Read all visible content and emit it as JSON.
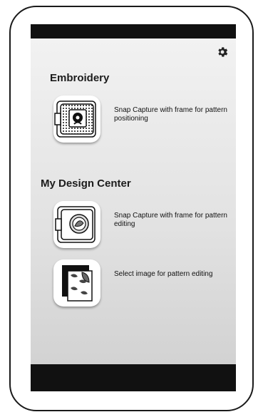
{
  "sections": {
    "embroidery": {
      "title": "Embroidery",
      "items": [
        {
          "label": "Snap Capture with frame for pattern positioning",
          "icon": "embroidery-frame-icon"
        }
      ]
    },
    "design_center": {
      "title": "My Design Center",
      "items": [
        {
          "label": "Snap Capture with frame for pattern editing",
          "icon": "design-frame-icon"
        },
        {
          "label": "Select image for pattern editing",
          "icon": "image-select-icon"
        }
      ]
    }
  },
  "header": {
    "settings_icon": "gear-icon"
  },
  "colors": {
    "status_bar": "#111111",
    "nav_bar": "#111111",
    "text": "#111111"
  }
}
